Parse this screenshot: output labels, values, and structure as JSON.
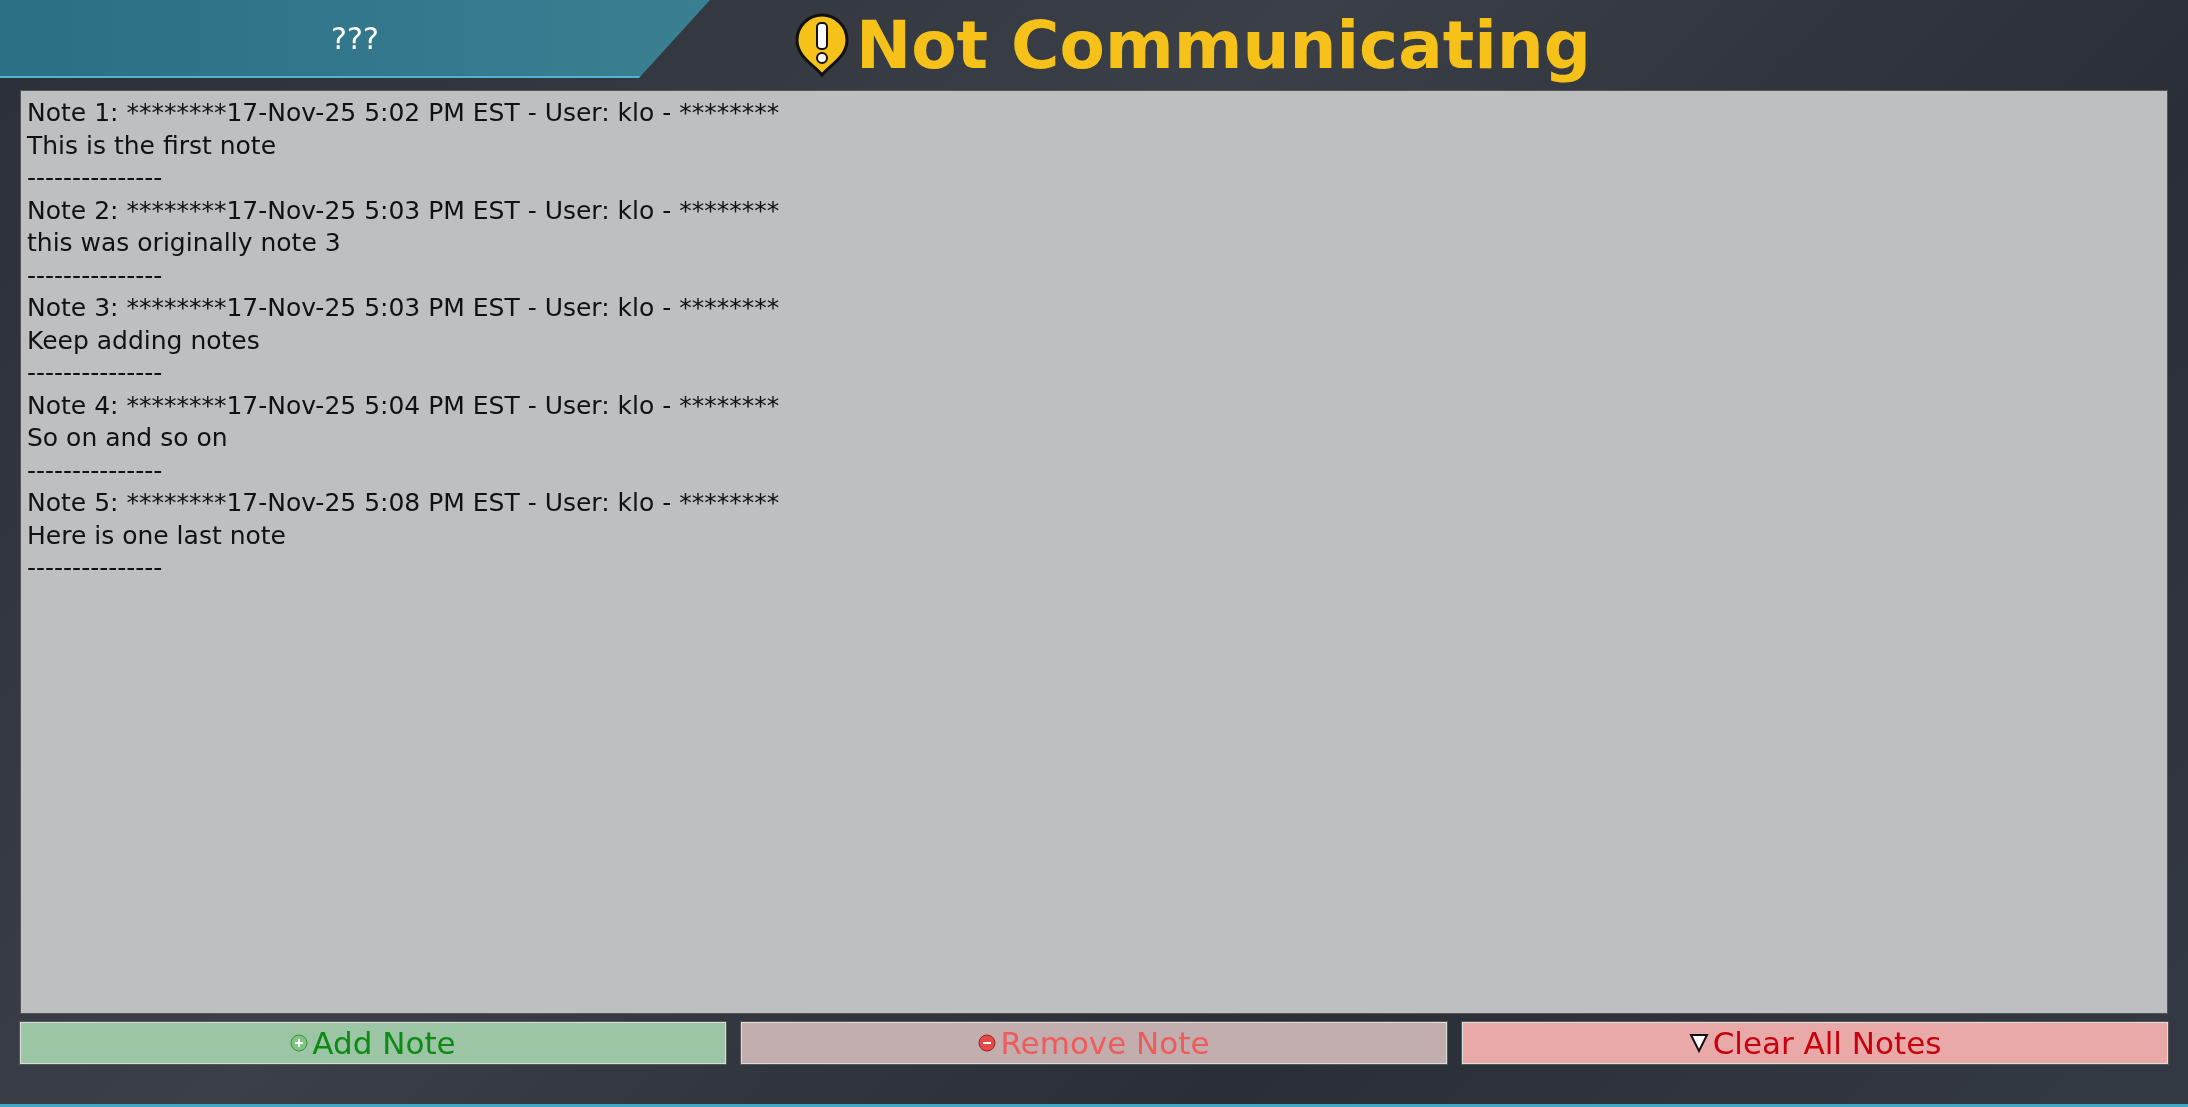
{
  "header": {
    "title": "???",
    "status": "Not Communicating"
  },
  "notes": [
    {
      "heading": "Note 1: ********17-Nov-25 5:02 PM EST - User: klo - ********",
      "body": "This is the first note",
      "separator": "---------------"
    },
    {
      "heading": "Note 2: ********17-Nov-25 5:03 PM EST - User: klo - ********",
      "body": "this was originally note 3",
      "separator": "---------------"
    },
    {
      "heading": "Note 3: ********17-Nov-25 5:03 PM EST - User: klo - ********",
      "body": "Keep adding notes",
      "separator": "---------------"
    },
    {
      "heading": "Note 4: ********17-Nov-25 5:04 PM EST - User: klo - ********",
      "body": "So on and so on",
      "separator": "---------------"
    },
    {
      "heading": "Note 5: ********17-Nov-25 5:08 PM EST - User: klo - ********",
      "body": "Here is one last note",
      "separator": "---------------"
    }
  ],
  "buttons": [
    {
      "kind": "add",
      "label": "Add Note"
    },
    {
      "kind": "remove",
      "label": "Remove Note"
    },
    {
      "kind": "clear",
      "label": "Clear All Notes"
    }
  ]
}
